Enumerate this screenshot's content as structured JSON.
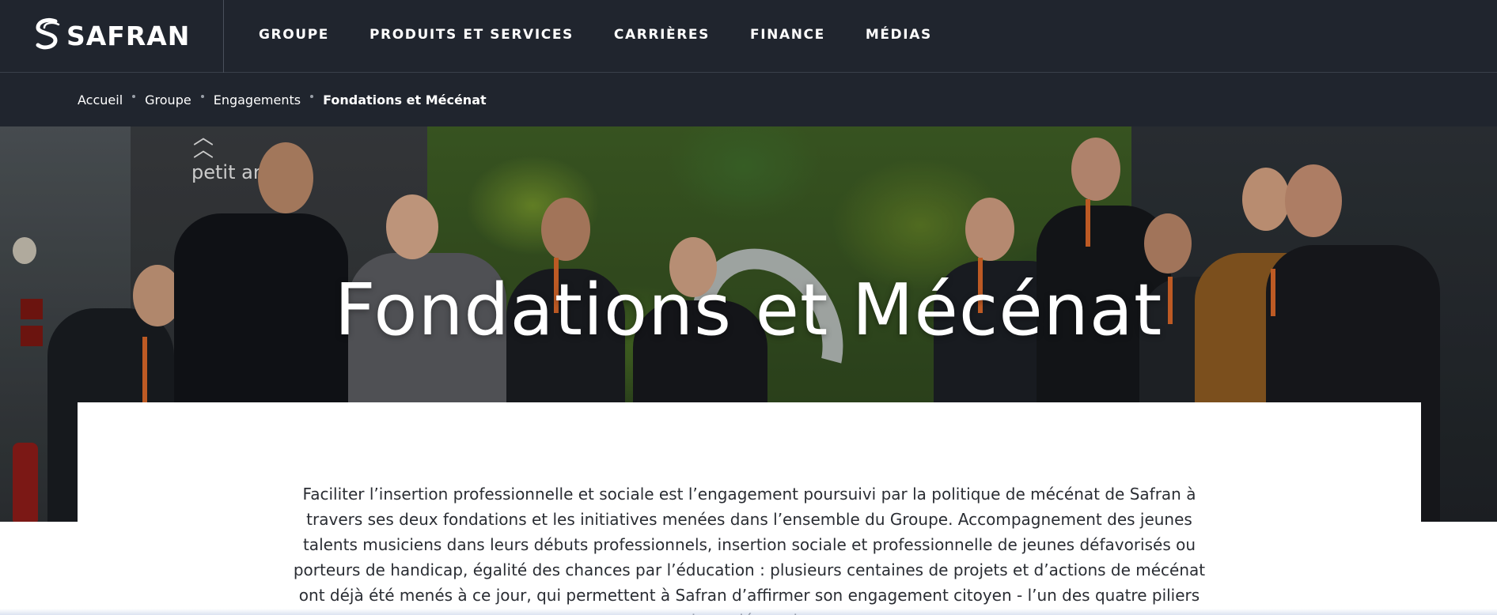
{
  "brand": {
    "name": "SAFRAN",
    "logo_icon": "safran-s-icon"
  },
  "nav": {
    "items": [
      {
        "label": "GROUPE"
      },
      {
        "label": "PRODUITS ET SERVICES"
      },
      {
        "label": "CARRIÈRES"
      },
      {
        "label": "FINANCE"
      },
      {
        "label": "MÉDIAS"
      }
    ]
  },
  "breadcrumb": {
    "items": [
      {
        "label": "Accueil"
      },
      {
        "label": "Groupe"
      },
      {
        "label": "Engagements"
      }
    ],
    "current": "Fondations et Mécénat"
  },
  "hero": {
    "title": "Fondations et Mécénat",
    "sign_text": "petit ar"
  },
  "intro": {
    "text": "Faciliter l’insertion professionnelle et sociale est l’engagement poursuivi par la politique de mécénat de Safran à travers ses deux fondations et les initiatives menées dans l’ensemble du Groupe. Accompagnement des jeunes talents musiciens dans leurs débuts professionnels, insertion sociale et professionnelle de jeunes défavorisés ou porteurs de handicap, égalité des chances par l’éducation : plusieurs centaines de projets et d’actions de mécénat ont déjà été menés à ce jour, qui permettent à Safran d’affirmer son engagement citoyen - l’un des quatre piliers de sa démarche"
  },
  "colors": {
    "header_bg": "#20252e",
    "text_white": "#ffffff",
    "body_text": "#2a2d33"
  }
}
